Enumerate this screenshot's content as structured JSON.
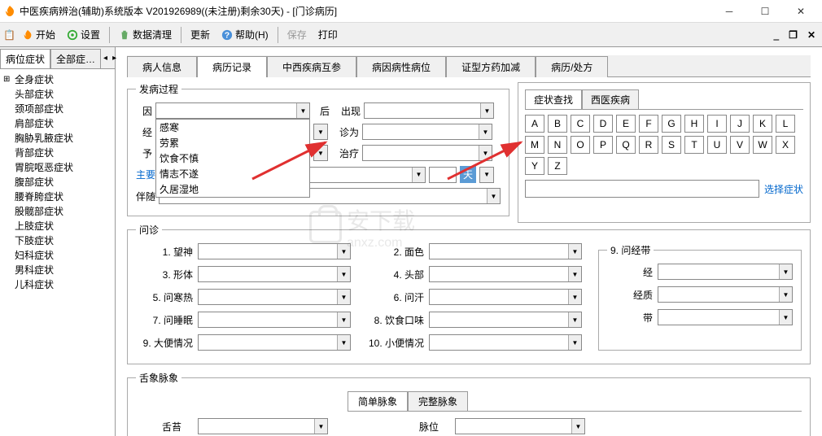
{
  "window": {
    "title": "中医疾病辨治(辅助)系统版本 V201926989((未注册)剩余30天) - [门诊病历]"
  },
  "toolbar": {
    "start": "开始",
    "settings": "设置",
    "cleanup": "数据清理",
    "update": "更新",
    "help": "帮助(H)",
    "save": "保存",
    "print": "打印"
  },
  "sidebar": {
    "tab1": "病位症状",
    "tab2": "全部症…",
    "items": [
      "全身症状",
      "头部症状",
      "颈项部症状",
      "肩部症状",
      "胸胁乳腋症状",
      "背部症状",
      "胃脘呕恶症状",
      "腹部症状",
      "腰脊胯症状",
      "股髋部症状",
      "上肢症状",
      "下肢症状",
      "妇科症状",
      "男科症状",
      "儿科症状"
    ]
  },
  "mainTabs": [
    "病人信息",
    "病历记录",
    "中西疾病互参",
    "病因病性病位",
    "证型方药加减",
    "病历/处方"
  ],
  "disease": {
    "legend": "发病过程",
    "yin": "因",
    "hou": "后",
    "chuxian": "出现",
    "jing": "经",
    "yu": "予",
    "zhenwei": "诊为",
    "zhiliao": "治疗",
    "main_cond": "主要病症",
    "tian": "天",
    "bansui": "伴随",
    "dd_options": [
      "感寒",
      "劳累",
      "饮食不慎",
      "情志不遂",
      "久居湿地"
    ]
  },
  "rightPanel": {
    "tab1": "症状查找",
    "tab2": "西医疾病",
    "keys": [
      "A",
      "B",
      "C",
      "D",
      "E",
      "F",
      "G",
      "H",
      "I",
      "J",
      "K",
      "L",
      "M",
      "N",
      "O",
      "P",
      "Q",
      "R",
      "S",
      "T",
      "U",
      "V",
      "W",
      "X",
      "Y",
      "Z"
    ],
    "choose": "选择症状"
  },
  "wenzhen": {
    "legend": "问诊",
    "items_left": [
      {
        "n": "1.",
        "l": "望神"
      },
      {
        "n": "3.",
        "l": "形体"
      },
      {
        "n": "5.",
        "l": "问寒热"
      },
      {
        "n": "7.",
        "l": "问睡眠"
      },
      {
        "n": "9.",
        "l": "大便情况"
      }
    ],
    "items_mid": [
      {
        "n": "2.",
        "l": "面色"
      },
      {
        "n": "4.",
        "l": "头部"
      },
      {
        "n": "6.",
        "l": "问汗"
      },
      {
        "n": "8.",
        "l": "饮食口味"
      },
      {
        "n": "10.",
        "l": "小便情况"
      }
    ],
    "right_title": "9. 问经带",
    "right_items": [
      "经",
      "经质",
      "带"
    ]
  },
  "tongue": {
    "legend": "舌象脉象",
    "subtab1": "简单脉象",
    "subtab2": "完整脉象",
    "shetai": "舌苔",
    "maiwei": "脉位"
  },
  "watermark": {
    "text1": "安下载",
    "text2": "anxz.com"
  }
}
